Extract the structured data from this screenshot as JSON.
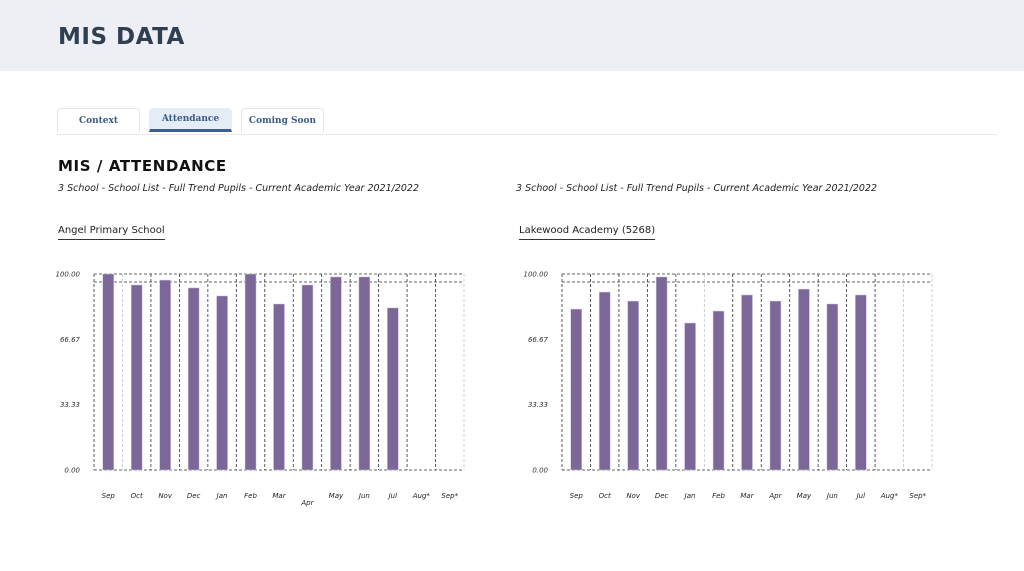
{
  "header": {
    "title": "MIS DATA"
  },
  "tabs": [
    {
      "label": "Context",
      "active": false
    },
    {
      "label": "Attendance",
      "active": true
    },
    {
      "label": "Coming Soon",
      "active": false
    }
  ],
  "section": {
    "title": "MIS / ATTENDANCE"
  },
  "colors": {
    "bar": "#7b6899",
    "accent": "#3a5f90"
  },
  "chart_data": [
    {
      "type": "bar",
      "title": "Angel Primary School",
      "subtitle": "3 School - School List - Full Trend Pupils - Current Academic Year 2021/2022",
      "xlabel": "",
      "ylabel": "",
      "categories": [
        "Sep",
        "Oct",
        "Nov",
        "Dec",
        "Jan",
        "Feb",
        "Mar",
        "Apr",
        "May",
        "Jun",
        "Jul",
        "Aug*",
        "Sep*"
      ],
      "values": [
        100,
        94.4,
        96.9,
        92.9,
        88.8,
        100,
        84.7,
        94.4,
        98.5,
        98.5,
        82.7,
        null,
        null
      ],
      "ylim": [
        0,
        100
      ],
      "yticks": [
        "0.00",
        "33.33",
        "66.67",
        "100.00"
      ],
      "ytick_values": [
        0,
        33.33,
        66.67,
        100
      ],
      "grid": true
    },
    {
      "type": "bar",
      "title": "Lakewood Academy (5268)",
      "subtitle": "3 School - School List - Full Trend Pupils - Current Academic Year 2021/2022",
      "xlabel": "",
      "ylabel": "",
      "categories": [
        "Sep",
        "Oct",
        "Nov",
        "Dec",
        "Jan",
        "Feb",
        "Mar",
        "Apr",
        "May",
        "Jun",
        "Jul",
        "Aug*",
        "Sep*"
      ],
      "values": [
        82.1,
        90.8,
        86.2,
        98.5,
        75.0,
        81.1,
        89.3,
        86.2,
        92.3,
        84.7,
        89.3,
        null,
        null
      ],
      "ylim": [
        0,
        100
      ],
      "yticks": [
        "0.00",
        "33.33",
        "66.67",
        "100.00"
      ],
      "ytick_values": [
        0,
        33.33,
        66.67,
        100
      ],
      "grid": true
    }
  ]
}
